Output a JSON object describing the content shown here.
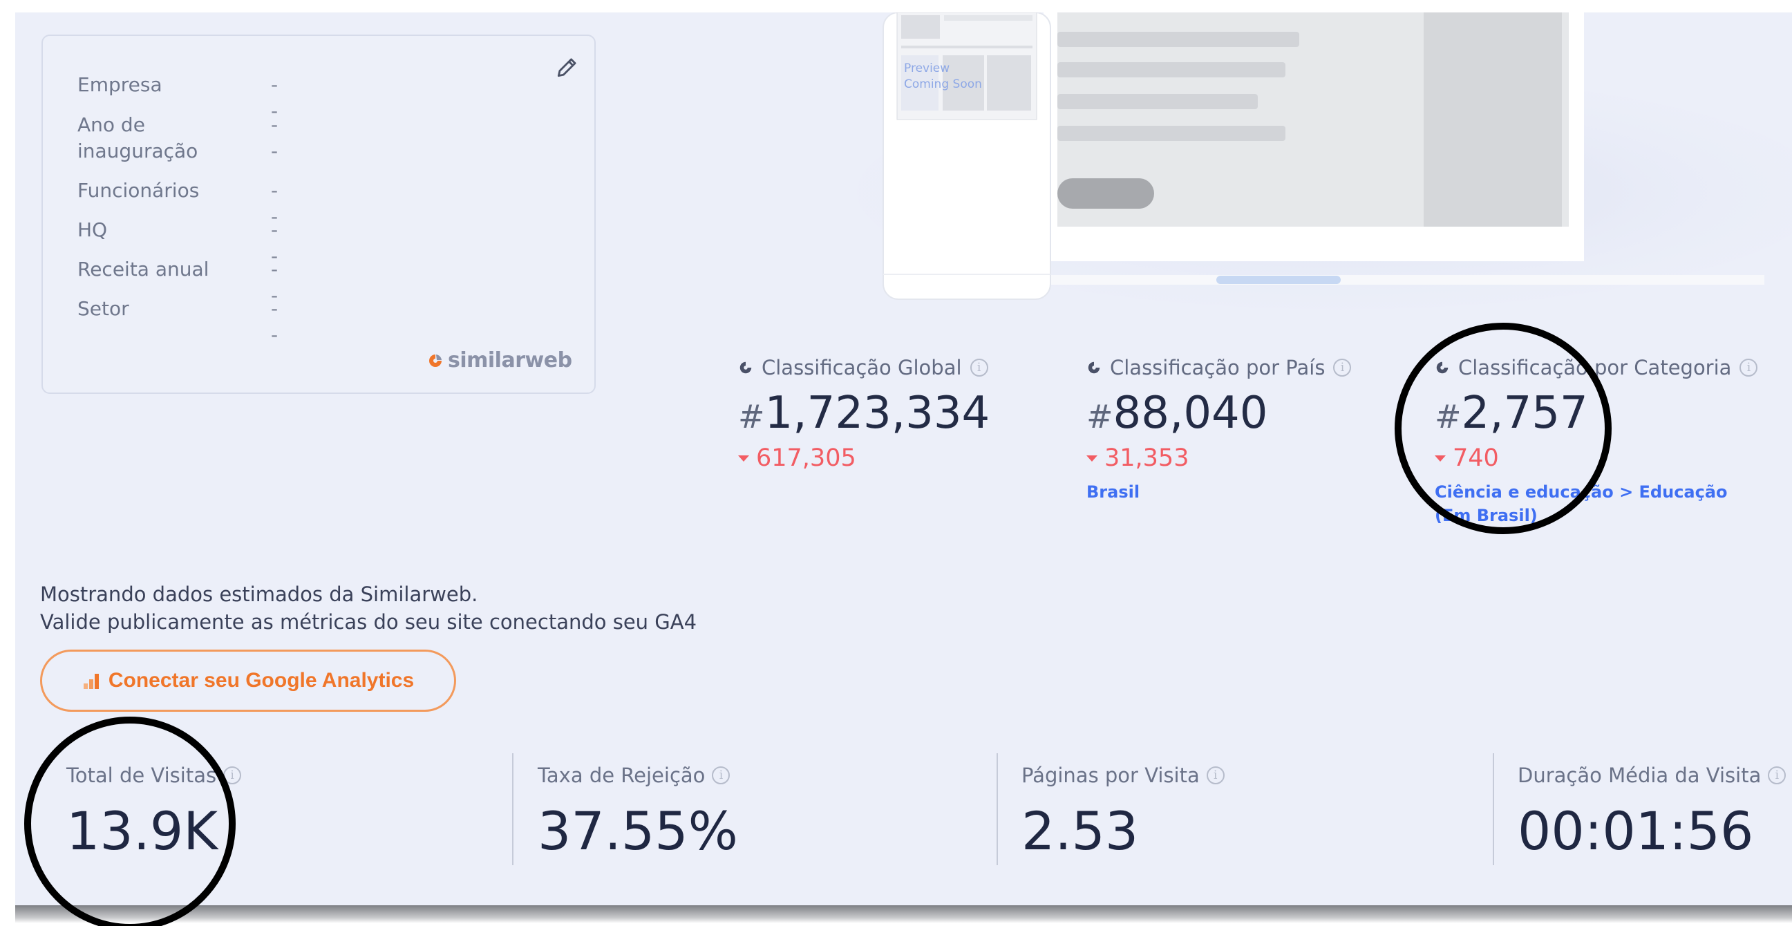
{
  "company_card": {
    "rows": [
      {
        "label": "Empresa",
        "value": "- -"
      },
      {
        "label": "Ano de inauguração",
        "value": "- -"
      },
      {
        "label": "Funcionários",
        "value": "- -"
      },
      {
        "label": "HQ",
        "value": "- -"
      },
      {
        "label": "Receita anual",
        "value": "- -"
      },
      {
        "label": "Setor",
        "value": "- -"
      }
    ],
    "brand": "similarweb"
  },
  "illustration": {
    "preview_text_line1": "Preview",
    "preview_text_line2": "Coming Soon"
  },
  "ranks": [
    {
      "title": "Classificação Global",
      "hash": "#",
      "value": "1,723,334",
      "delta": "617,305",
      "sub": ""
    },
    {
      "title": "Classificação por País",
      "hash": "#",
      "value": "88,040",
      "delta": "31,353",
      "sub": "Brasil"
    },
    {
      "title": "Classificação por Categoria",
      "hash": "#",
      "value": "2,757",
      "delta": "740",
      "sub_line1": "Ciência e educação > Educação",
      "sub_line2": "(Em Brasil)"
    }
  ],
  "message": {
    "line1": "Mostrando dados estimados da Similarweb.",
    "line2": "Valide publicamente as métricas do seu site conectando seu GA4"
  },
  "ga_button": {
    "label": "Conectar seu Google Analytics"
  },
  "metrics": [
    {
      "title": "Total de Visitas",
      "value": "13.9K"
    },
    {
      "title": "Taxa de Rejeição",
      "value": "37.55%"
    },
    {
      "title": "Páginas por Visita",
      "value": "2.53"
    },
    {
      "title": "Duração Média da Visita",
      "value": "00:01:56"
    }
  ],
  "colors": {
    "background": "#eceff9",
    "accent_orange": "#f0762a",
    "negative_red": "#f25c63",
    "link_blue": "#3f6ff2",
    "text_dark": "#1f2742"
  }
}
